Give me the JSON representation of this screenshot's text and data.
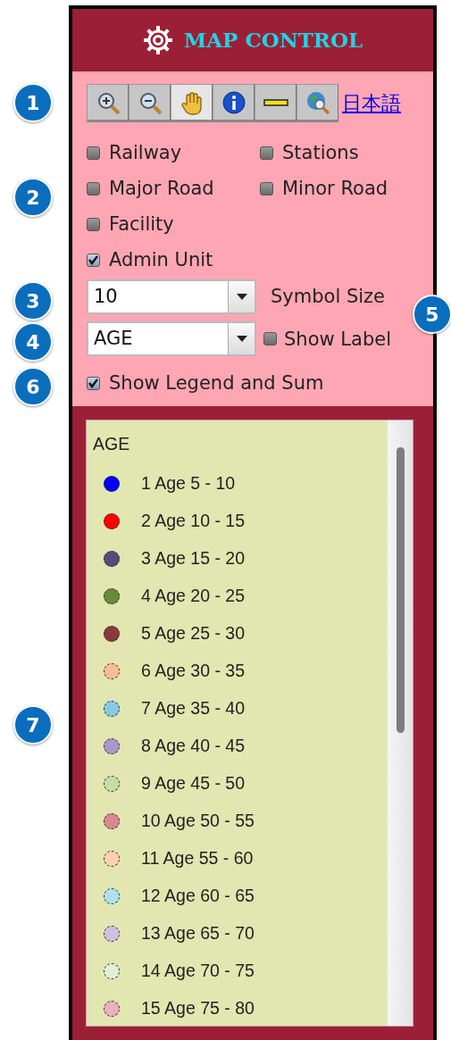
{
  "header": {
    "title": "MAP CONTROL"
  },
  "toolbar": {
    "tools": [
      {
        "kind": "zoom-in",
        "selected": false
      },
      {
        "kind": "zoom-out",
        "selected": false
      },
      {
        "kind": "pan",
        "selected": true
      },
      {
        "kind": "info",
        "selected": false
      },
      {
        "kind": "measure",
        "selected": false
      },
      {
        "kind": "globe-search",
        "selected": false
      }
    ],
    "language_link": "日本語"
  },
  "layers": [
    {
      "label": "Railway",
      "checked": false
    },
    {
      "label": "Stations",
      "checked": false
    },
    {
      "label": "Major Road",
      "checked": false
    },
    {
      "label": "Minor Road",
      "checked": false
    },
    {
      "label": "Facility",
      "checked": false
    },
    {
      "label": "Admin Unit",
      "checked": true
    }
  ],
  "symbol_size": {
    "value": "10",
    "label": "Symbol Size"
  },
  "attribute": {
    "value": "AGE",
    "show_label": {
      "label": "Show Label",
      "checked": false
    }
  },
  "show_legend": {
    "label": "Show Legend and Sum",
    "checked": true
  },
  "legend": {
    "title": "AGE",
    "items": [
      {
        "label": "1 Age 5 - 10",
        "color": "#0000ff"
      },
      {
        "label": "2 Age 10 - 15",
        "color": "#ff0000"
      },
      {
        "label": "3 Age 15 - 20",
        "color": "#5a4a7a"
      },
      {
        "label": "4 Age 20 - 25",
        "color": "#6a8a3a"
      },
      {
        "label": "5 Age 25 - 30",
        "color": "#8a3a3a"
      },
      {
        "label": "6 Age 30 - 35",
        "color": "#f8c090"
      },
      {
        "label": "7 Age 35 - 40",
        "color": "#88c8e0"
      },
      {
        "label": "8 Age 40 - 45",
        "color": "#a898c8"
      },
      {
        "label": "9 Age 45 - 50",
        "color": "#c8dca8"
      },
      {
        "label": "10 Age 50 - 55",
        "color": "#d88890"
      },
      {
        "label": "11 Age 55 - 60",
        "color": "#ffd0b0"
      },
      {
        "label": "12 Age 60 - 65",
        "color": "#b0e0f0"
      },
      {
        "label": "13 Age 65 - 70",
        "color": "#d0c0e0"
      },
      {
        "label": "14 Age 70 - 75",
        "color": "#e0f0d8"
      },
      {
        "label": "15 Age 75 - 80",
        "color": "#e8b0c0"
      }
    ]
  },
  "callouts": [
    {
      "number": "1"
    },
    {
      "number": "2"
    },
    {
      "number": "3"
    },
    {
      "number": "5"
    },
    {
      "number": "4"
    },
    {
      "number": "6"
    },
    {
      "number": "7"
    }
  ]
}
